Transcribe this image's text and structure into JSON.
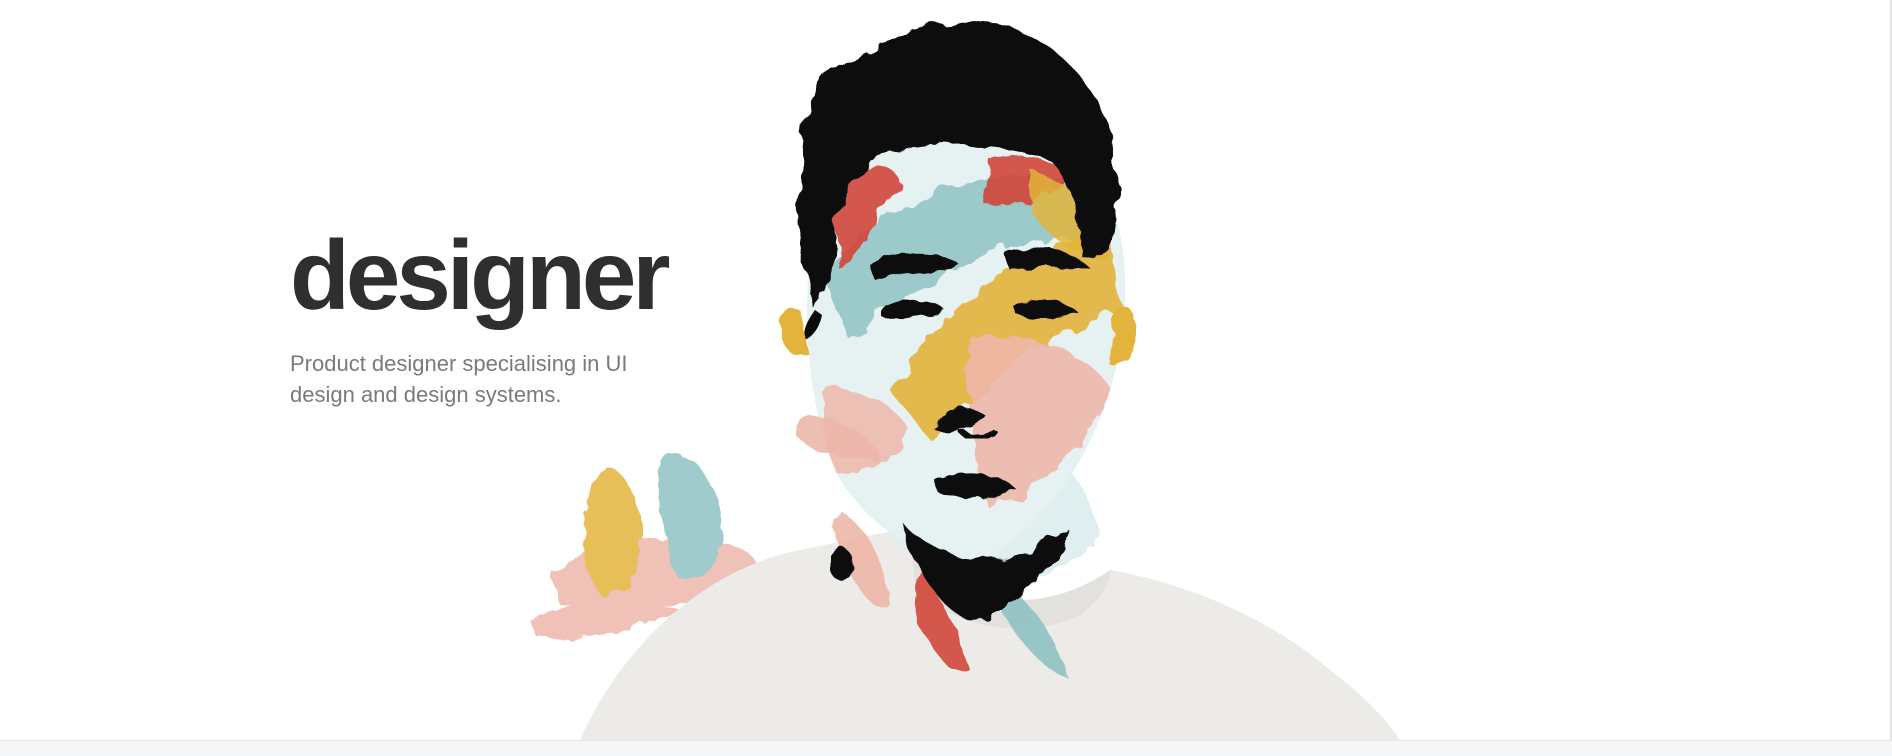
{
  "hero": {
    "title": "designer",
    "subtitle": "Product designer specialising in UI design and design systems."
  },
  "portrait": {
    "icon": "watercolor-portrait-illustration",
    "colors": {
      "ink": "#0b0b0b",
      "shirt": "#ecebe7",
      "teal": "#8fc3c4",
      "mustard": "#e3b43a",
      "red": "#d2463a",
      "pink": "#eeb7aa"
    }
  },
  "theme": {
    "title_color": "#2f2f2f",
    "subtitle_color": "#7a7a7a",
    "background": "#ffffff"
  }
}
